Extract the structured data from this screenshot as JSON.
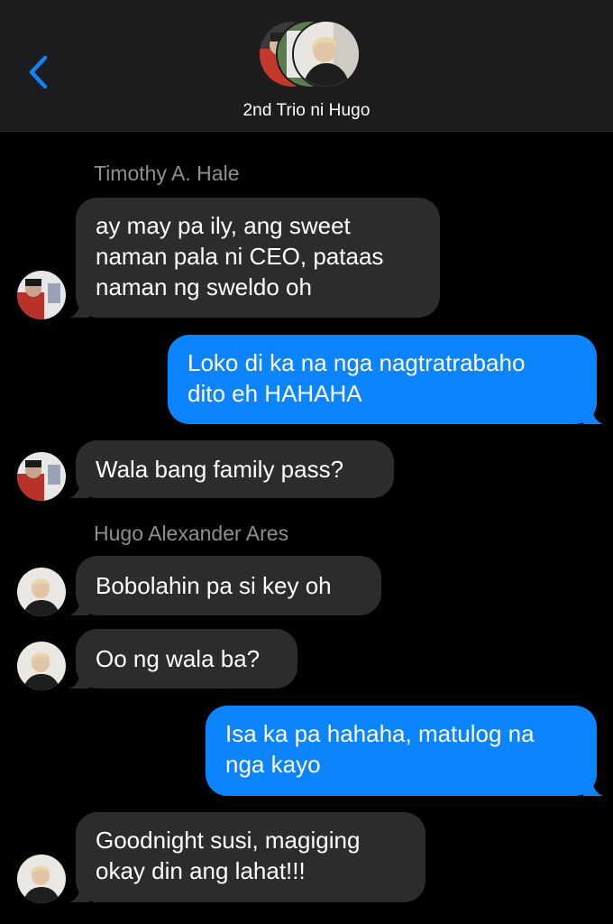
{
  "header": {
    "group_name": "2nd Trio ni Hugo",
    "back_icon": "chevron-left-icon",
    "accent": "#0b84fe"
  },
  "thread": {
    "senders": [
      "Timothy A. Hale",
      "Hugo Alexander Ares"
    ],
    "messages": [
      {
        "side": "in",
        "sender": "Timothy A. Hale",
        "text": "ay may pa ily, ang sweet\nnaman pala ni CEO, pataas\nnaman ng sweldo oh"
      },
      {
        "side": "out",
        "text": "Loko di ka na nga nagtratrabaho\ndito eh HAHAHA"
      },
      {
        "side": "in",
        "sender": "Timothy A. Hale",
        "text": "Wala bang family pass?"
      },
      {
        "side": "in",
        "sender": "Hugo Alexander Ares",
        "text": "Bobolahin pa si key oh"
      },
      {
        "side": "in",
        "sender": "Hugo Alexander Ares",
        "text": "Oo ng wala ba?"
      },
      {
        "side": "out",
        "text": "Isa ka pa hahaha, matulog na\nnga kayo"
      },
      {
        "side": "in",
        "sender": "Hugo Alexander Ares",
        "text": "Goodnight susi, magiging\nokay din ang lahat!!!"
      }
    ]
  },
  "colors": {
    "incoming_bubble": "#2c2c2e",
    "outgoing_bubble": "#0b84fe",
    "sender_label": "#8e8e93",
    "background": "#000000"
  }
}
